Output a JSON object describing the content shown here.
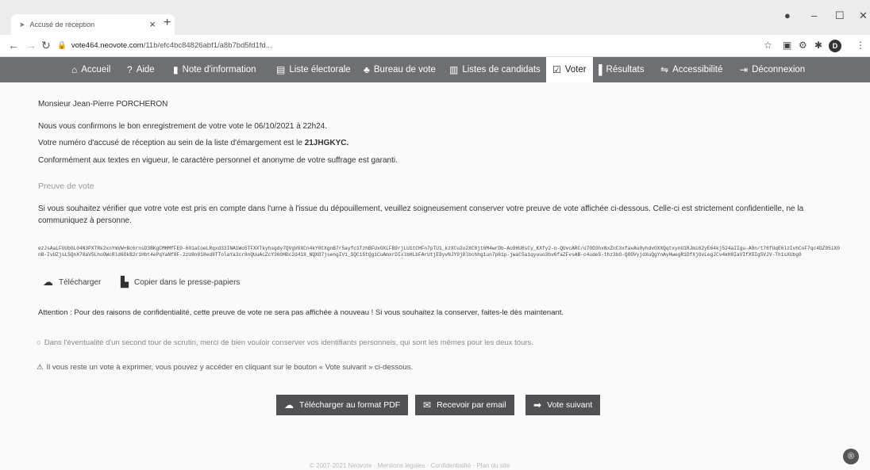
{
  "browser": {
    "tab_title": "Accusé de réception",
    "tab_close": "×",
    "new_tab": "+",
    "url_host": "vote464.neovote.com",
    "url_path": "/11b/efc4bc84826abf1/a8b7bd5fd1fd... ",
    "profile_initial": "D",
    "icons": [
      "back-icon",
      "forward-icon",
      "reload-icon",
      "lock-icon",
      "star-icon",
      "extension-icon",
      "puzzle-icon"
    ]
  },
  "nav": {
    "accueil": "Accueil",
    "aide": "Aide",
    "note": "Note d'information",
    "liste": "Liste électorale",
    "bureau": "Bureau de vote",
    "candidats": "Listes de candidats",
    "voter": "Voter",
    "resultats": "Résultats",
    "accessibilite": "Accessibilité",
    "deconnexion": "Déconnexion"
  },
  "main": {
    "salutation": "Monsieur Jean-Pierre PORCHERON",
    "confirm": "Nous vous confirmons le bon enregistrement de votre vote le 06/10/2021 à 22h24.",
    "receipt_prefix": "Votre numéro d'accusé de réception au sein de la liste d'émargement est le ",
    "receipt_code": "21JHGKYC.",
    "confidential": "Conformément aux textes en vigueur, le caractère personnel et anonyme de votre suffrage est garanti.",
    "proof_title": "Preuve de vote",
    "proof_intro": "Si vous souhaitez vérifier que votre vote est pris en compte dans l'urne à l'issue du dépouillement, veuillez soigneusement conserver votre preuve de vote affichée ci-dessous. Celle-ci est strictement confidentielle, ne la communiquez à personne.",
    "proof_text": "ezJsAaLFUUbGL04N3PXTRk2xnYmVW+Bc6rnsD3BKgCMHMfFE0-601aCoeLRqxd33INA1Wo5TFXXTkyhsgdy7QVgV0XCn4kY0tXgnB7r5ayfc1TzhBFUxOXLFB9rjLU1tCHFn7pTU1_kzXCu2o2XC8jt6M4wrDb-Ao9HU8sCy_KXfy2-n-QUvcARC/u70D3hxNxZnC3xfavAu0yhdvOXXQqtxynU1RJmi62yE64kj524aIIgu-A9n/t76fUqE6lzIvhCoF7qc4DZ95iX0nB-IvUZjsL5QnX78aV5LhoOWcRld6OkB2r1Hbt4ePqYaNf8F-2zU8n018ed8TTolaYa3cr8nQUuAcZcY36OHDc2d418_NQXO7jsengIV1_5QC15tQg1CuAmxrDIxlbHLbFArUtjE9yvNJY9j8lbchhg1un7p61p-jwaC5a1qyuuo3bv6faZFvsAB-c4ude5-thz3bO-QOOVyjdXuQgYnAyHwegR1DfXjOvLegJCv4kH0IaVIfX5IgSVJV-Th1sXUbg0",
    "download": "Télécharger",
    "copy": "Copier dans le presse-papiers",
    "warning": "Attention : Pour des raisons de confidentialité, cette preuve de vote ne sera pas affichée à nouveau ! Si vous souhaitez la conserver, faites-le dès maintenant.",
    "note1": "Dans l'éventualité d'un second tour de scrutin, merci de bien vouloir conserver vos identifiants personnels, qui sont les mêmes pour les deux tours.",
    "note2": "Il vous reste un vote à exprimer, vous pouvez y accéder en cliquant sur le bouton « Vote suivant » ci-dessous."
  },
  "buttons": {
    "pdf": "Télécharger au format PDF",
    "email": "Recevoir par email",
    "next": "Vote suivant"
  },
  "footer": "© 2007-2021 Neovote · Mentions légales · Confidentialité · Plan du site"
}
